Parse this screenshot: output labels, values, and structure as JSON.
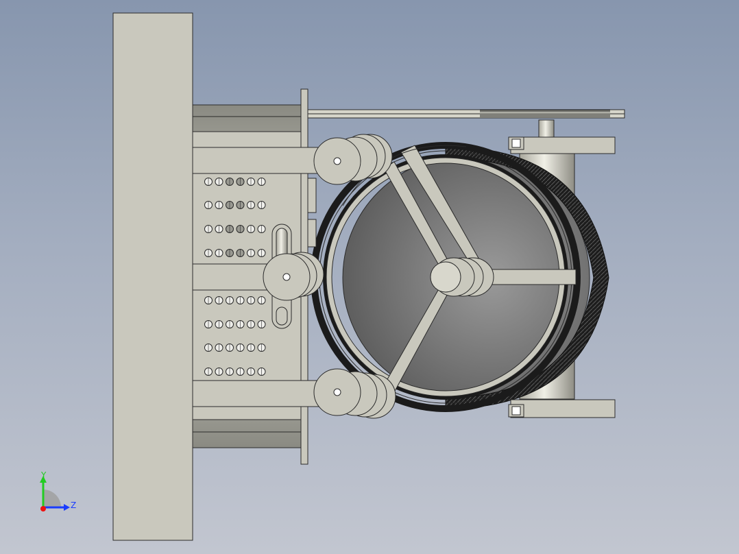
{
  "triad": {
    "y_label": "Y",
    "z_label": "Z",
    "y_color": "#22cc22",
    "z_color": "#1a3cff",
    "x_color": "#ee1111"
  },
  "colors": {
    "background_top": "#8796ae",
    "background_bottom": "#c2c6d0",
    "part_fill": "#c9c8bd",
    "part_stroke": "#2a2a2a",
    "belt": "#1e1e1e",
    "drum_shade": "#7c7c7c"
  }
}
